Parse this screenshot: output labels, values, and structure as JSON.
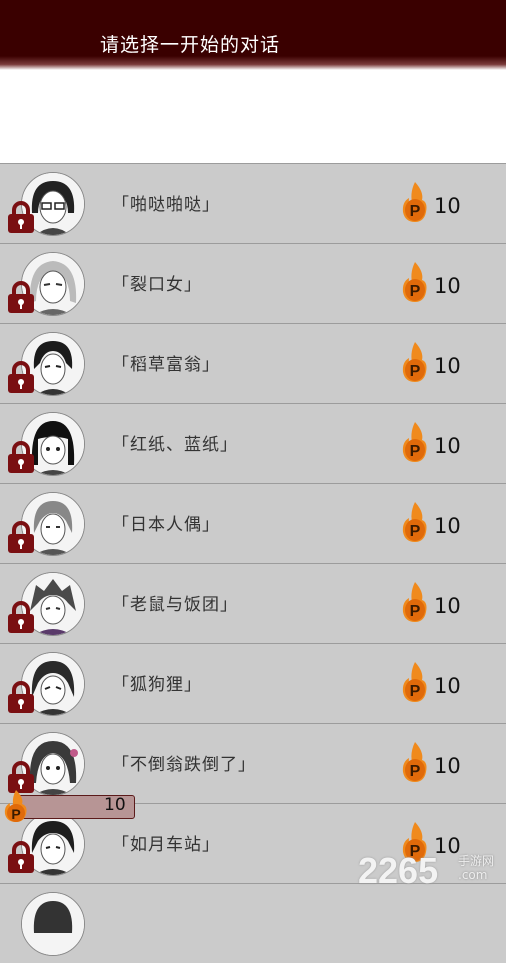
{
  "header": {
    "title": "请选择一开始的对话"
  },
  "conversations": [
    {
      "title": "「啪哒啪哒」",
      "cost": "10"
    },
    {
      "title": "「裂口女」",
      "cost": "10"
    },
    {
      "title": "「稻草富翁」",
      "cost": "10"
    },
    {
      "title": "「红纸、蓝纸」",
      "cost": "10"
    },
    {
      "title": "「日本人偶」",
      "cost": "10"
    },
    {
      "title": "「老鼠与饭团」",
      "cost": "10"
    },
    {
      "title": "「狐狗狸」",
      "cost": "10"
    },
    {
      "title": "「不倒翁跌倒了」",
      "cost": "10"
    },
    {
      "title": "「如月车站」",
      "cost": "10"
    }
  ],
  "points_bar": {
    "value": "10",
    "letter": "P"
  },
  "icons": {
    "avatar": "portrait-avatar-icon",
    "lock": "padlock-icon",
    "cost": "flame-p-coin-icon"
  },
  "colors": {
    "header_bg": "#3a0000",
    "row_bg": "#cbcbcb",
    "lock": "#7a0f12",
    "flame": "#f08a1c"
  },
  "watermark": {
    "number": "2265",
    "site_cn": "手游网",
    "site_url": ".com"
  }
}
